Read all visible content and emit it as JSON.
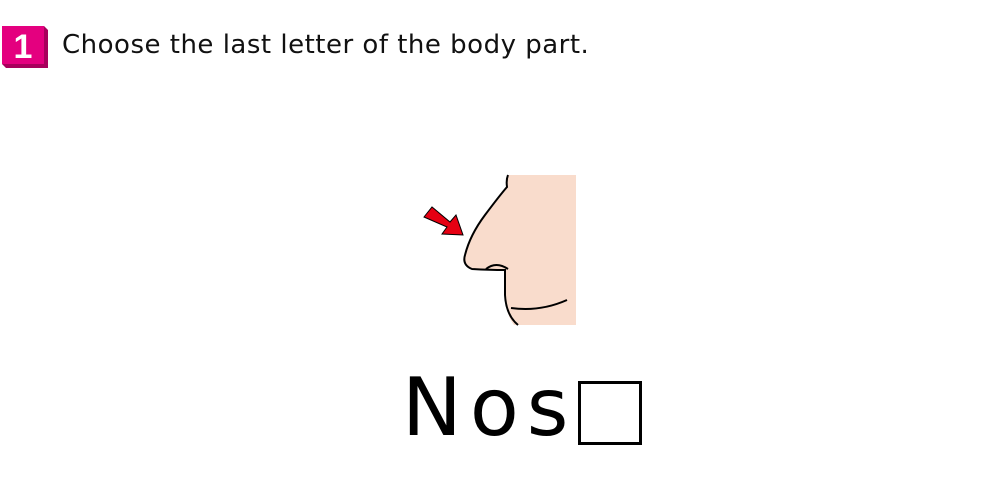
{
  "question": {
    "number": "1",
    "text": "Choose the last letter of the body part."
  },
  "word": {
    "shown": "Nos",
    "blank": ""
  },
  "colors": {
    "badge": "#e4007f",
    "badge_shadow": "#a8005c",
    "skin": "#f9dccc",
    "arrow": "#e60012"
  },
  "icons": {
    "picture": "nose-picture",
    "pointer": "red-arrow-icon"
  }
}
